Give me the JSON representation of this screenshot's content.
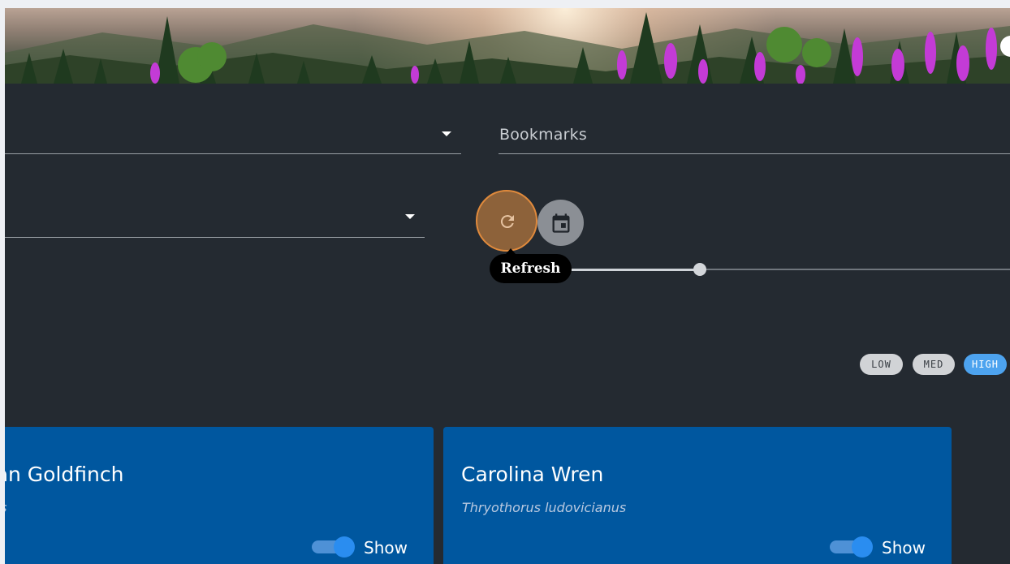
{
  "banner": {
    "alt": "Mountain forest with fireweed flowers"
  },
  "filters": {
    "select_top": {
      "value": ""
    },
    "bookmarks": {
      "placeholder": "Bookmarks"
    },
    "select_second": {
      "value": ""
    }
  },
  "toolbar": {
    "refresh_icon": "refresh-icon",
    "calendar_icon": "calendar-icon",
    "tooltip": "Refresh"
  },
  "slider": {
    "value_fraction": 0.27
  },
  "priority": {
    "chips": [
      {
        "label": "LOW",
        "active": false
      },
      {
        "label": "MED",
        "active": false
      },
      {
        "label": "HIGH",
        "active": true
      }
    ]
  },
  "cards": [
    {
      "title": "ican Goldfinch",
      "scientific": "ristis",
      "toggle_label": "Show",
      "toggle_on": true
    },
    {
      "title": "Carolina Wren",
      "scientific": "Thryothorus ludovicianus",
      "toggle_label": "Show",
      "toggle_on": true
    }
  ],
  "colors": {
    "background": "#242a31",
    "card": "#00579f",
    "accent": "#4da3ef",
    "refresh_highlight": "#e08a3c"
  }
}
